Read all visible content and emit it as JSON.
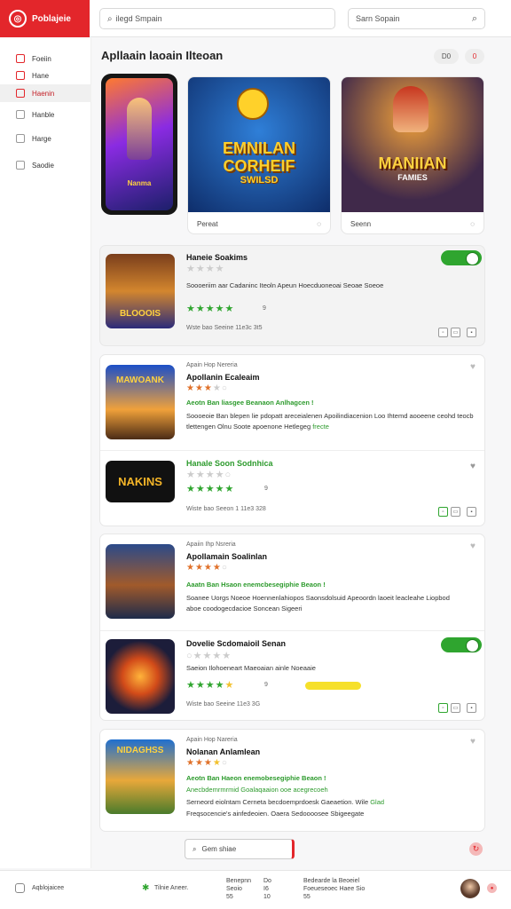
{
  "header": {
    "logo_text": "Poblajeie",
    "search_placeholder": "ilegd Smpain",
    "search2_placeholder": "Sarn Sopain",
    "search_icon": "search-icon",
    "search2_icon": "search-icon"
  },
  "sidebar": {
    "items": [
      {
        "label": "Foeiin",
        "icon": "home-icon"
      },
      {
        "label": "Hane",
        "icon": "page-icon"
      },
      {
        "label": "Haenin",
        "icon": "apps-icon",
        "active": true
      },
      {
        "label": "Hanble",
        "icon": "game-icon"
      },
      {
        "label": "Harge",
        "icon": "edit-icon"
      },
      {
        "label": "Saodie",
        "icon": "settings-icon"
      }
    ]
  },
  "featured": {
    "title": "Apllaain laoain Ilteoan",
    "pill1": "D0",
    "pill2": "0",
    "phone_caption": "Nanma",
    "cards": [
      {
        "art_title": "EMNILAN CORHEIF",
        "art_sub": "SWILSD",
        "caption": "Pereat"
      },
      {
        "art_title": "MANIIAN",
        "art_sub": "FAMIES",
        "caption": "Seenn"
      }
    ]
  },
  "apps": [
    {
      "title": "Haneie Soakims",
      "desc": "Soooeriim aar Cadaninc Iteoln Apeun Hoecduoneoai Seoae Soeoe",
      "rating_count": "9",
      "meta": "Wste bao Seeine 11e3c 3t5",
      "thumb_text": "BLOOOIS"
    },
    {
      "kicker": "Apain Hop Nereria",
      "title": "Apollanin Ecaleaim",
      "green": "Aeotn Ban liasgee Beanaon Anlhagcen !",
      "desc": "Soooeoie Ban blepen lie pdopatt areceialenen Apoilindiacenion Loo Ihtemd aooeene ceohd teocb tlettengen Olnu Soote apoenone Hetlegeg",
      "desc_green": "frecte",
      "thumb_text": "MAWOANK"
    },
    {
      "title": "Hanale Soon Sodnhica",
      "rating_count": "9",
      "meta": "Wiste bao Seeon 1 11e3 328",
      "thumb_text": "NAKINS"
    },
    {
      "kicker": "Apaiin Ihp Nsreria",
      "title": "Apollamain Soalinlan",
      "green": "Aaatn Ban Hsaon enemcbesegiphie Beaon !",
      "desc": "Soanee Uorgs Noeoe Hoennenlahiopos Saonsdolsuid Apeoordn laoeit leacleahe Liopbod aboe coodogecdacioe Soncean Sigeeri",
      "thumb_text": ""
    },
    {
      "title": "Dovelie Scdomaioil Senan",
      "desc": "Saeion Ilohoeneart Maeoaian ainle Noeaaie",
      "rating_count": "9",
      "meta": "Wiste bao Seeine 11e3 3G",
      "thumb_text": ""
    },
    {
      "kicker": "Apain Hop Nareria",
      "title": "Nolanan Anlamlean",
      "green": "Aeotn Ban Haeon enemobesegiphie Beaon !",
      "green2": "Anecbdemrmrmid Goalaqaaion ooe acegrecoeh",
      "desc": "Serneord eiolntam Cerneta becdoemprdoesk Gaeaetion. Wile",
      "desc_green": "Glad",
      "desc2": "Freqsocencie's ainfedeoien. Oaera Sedoooosee Sbigeegate",
      "thumb_text": "NIDAGHSS"
    }
  ],
  "load_more": "Gem shiae",
  "footer": {
    "brand": "Aqblojaicee",
    "award": "Tilnie Aneer.",
    "col1_a": "Benepnn",
    "col1_b": "Seoio",
    "col1_c": "55",
    "col2_a": "Do",
    "col2_b": "I6",
    "col2_c": "10",
    "col3_a": "Bedearde la Beoeiel",
    "col3_b": "Foeueseoec Haee Sio",
    "col3_c": "55"
  },
  "colors": {
    "brand": "#e3262b",
    "accent_green": "#2fa52f"
  }
}
